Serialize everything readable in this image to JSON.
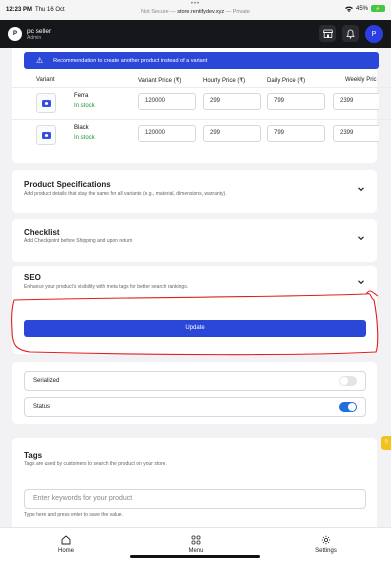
{
  "status_bar": {
    "time": "12:23 PM",
    "date": "Thu 16 Oct",
    "dots": "•••",
    "not_secure": "Not Secure —",
    "domain": "store.rentifydev.xyz",
    "private": "— Private",
    "battery": "45%"
  },
  "app_bar": {
    "avatar_letter": "P",
    "user_name": "pc seller",
    "user_role": "Admin",
    "profile_letter": "P"
  },
  "variants": {
    "banner": "Recommendation to create another product instead of a variant",
    "headers": {
      "variant": "Variant",
      "variant_price": "Variant Price (₹)",
      "hourly": "Hourly Price (₹)",
      "daily": "Daily Price (₹)",
      "weekly": "Weekly Pric"
    },
    "rows": [
      {
        "name": "Ferra",
        "stock": "In stock",
        "variant_price": "120000",
        "hourly": "299",
        "daily": "799",
        "weekly": "2399"
      },
      {
        "name": "Black",
        "stock": "In stock",
        "variant_price": "120000",
        "hourly": "299",
        "daily": "799",
        "weekly": "2399"
      }
    ]
  },
  "sections": {
    "specs": {
      "title": "Product Specifications",
      "subtitle": "Add product details that stay the same for all variants (e.g., material, dimensions, warranty)."
    },
    "checklist": {
      "title": "Checklist",
      "subtitle": "Add Checkpoint before Shipping and upon return"
    },
    "seo": {
      "title": "SEO",
      "subtitle": "Enhance your product's visibility with meta tags for better search rankings."
    }
  },
  "update_button": "Update",
  "toggles": {
    "serialized": {
      "label": "Serialized",
      "on": false
    },
    "status": {
      "label": "Status",
      "on": true
    }
  },
  "tags": {
    "title": "Tags",
    "subtitle": "Tags are used by customers to search the product on your store.",
    "placeholder": "Enter keywords for your product",
    "hint": "Type here and press enter to save the value."
  },
  "bottom_nav": {
    "home": "Home",
    "menu": "Menu",
    "settings": "Settings"
  },
  "colors": {
    "accent": "#2b47d8",
    "in_stock": "#1a9a3a",
    "annotation": "#e02020"
  }
}
